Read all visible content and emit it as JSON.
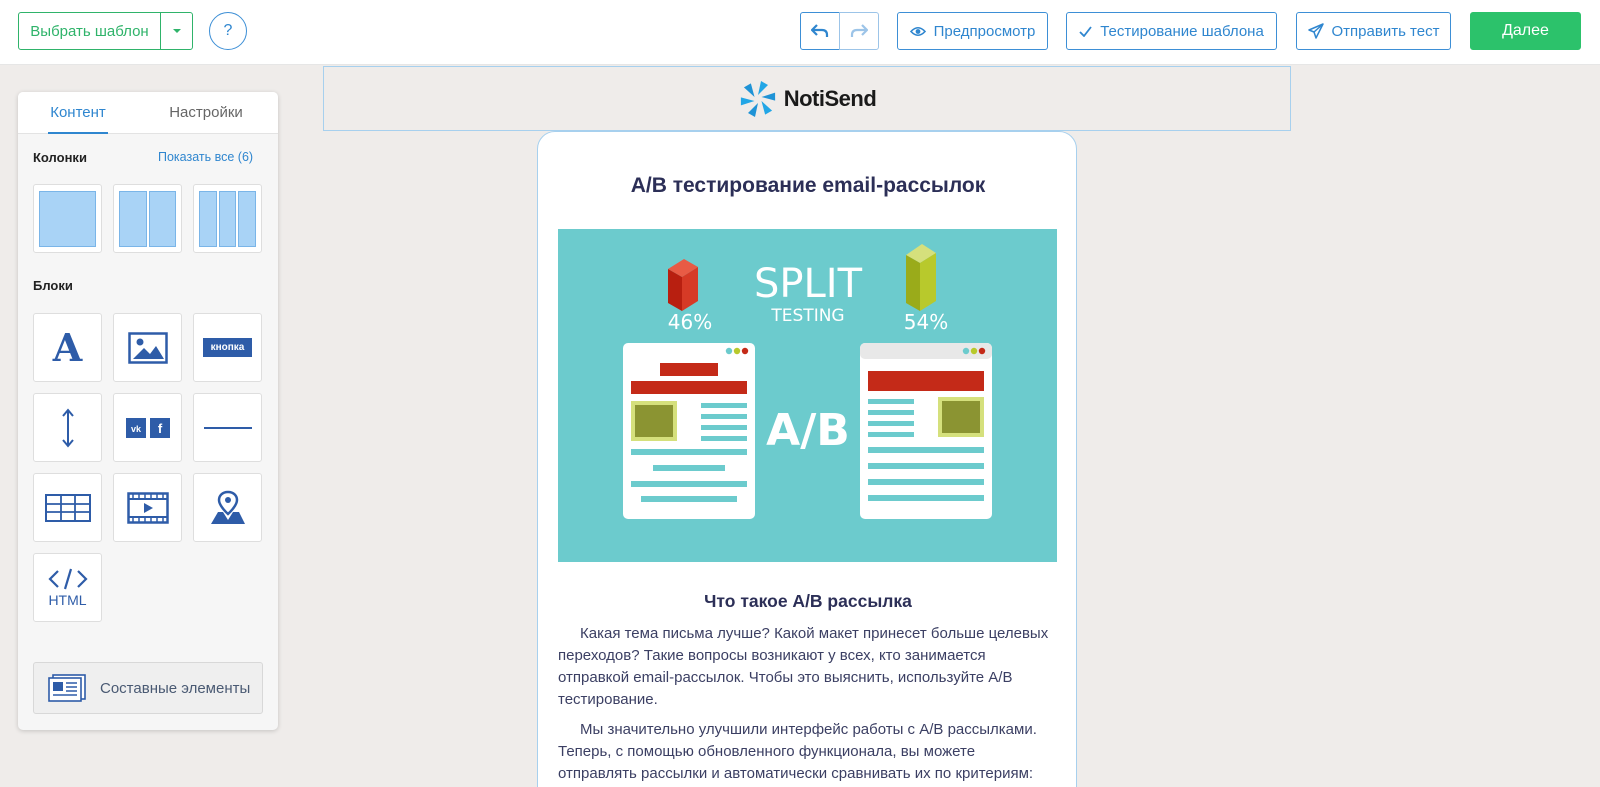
{
  "toolbar": {
    "choose_template": "Выбрать шаблон",
    "help": "?",
    "preview": "Предпросмотр",
    "test_template": "Тестирование шаблона",
    "send_test": "Отправить тест",
    "next": "Далее"
  },
  "sidebar": {
    "tabs": [
      "Контент",
      "Настройки"
    ],
    "columns_title": "Колонки",
    "show_all": "Показать все (6)",
    "blocks_title": "Блоки",
    "button_block_label": "кнопка",
    "html_block_label": "HTML",
    "composite": "Составные элементы"
  },
  "email": {
    "logo": "NotiSend",
    "title": "A/B тестирование email-рассылок",
    "hero": {
      "split": "SPLIT",
      "testing": "TESTING",
      "left_pct": "46%",
      "right_pct": "54%",
      "ab": "A/B"
    },
    "subtitle": "Что такое A/B рассылка",
    "paragraph1": "Какая тема письма лучше? Какой макет принесет больше целевых переходов? Такие вопросы возникают у всех, кто занимается отправкой email-рассылок. Чтобы это выяснить, используйте A/B тестирование.",
    "paragraph2": "Мы значительно улучшили интерфейс работы с A/B рассылками. Теперь, с помощью обновленного функционала, вы можете отправлять рассылки и автоматически сравнивать их по критериям:"
  },
  "colors": {
    "accent": "#2f86cf",
    "success": "#2cc26b",
    "hero_bg": "#6ccbcd"
  }
}
